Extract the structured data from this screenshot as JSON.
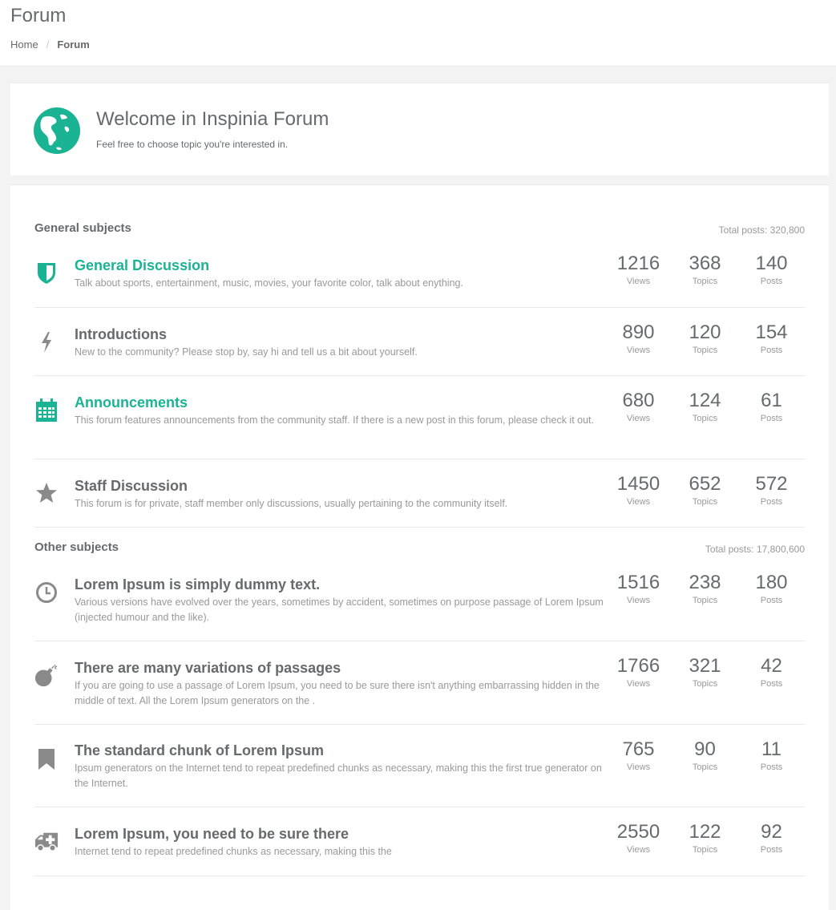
{
  "page": {
    "title": "Forum",
    "breadcrumb": {
      "home": "Home",
      "current": "Forum"
    }
  },
  "welcome": {
    "title": "Welcome in Inspinia Forum",
    "subtitle": "Feel free to choose topic you're interested in."
  },
  "labels": {
    "views": "Views",
    "topics": "Topics",
    "posts": "Posts"
  },
  "sections": [
    {
      "title": "General subjects",
      "total": "Total posts: 320,800",
      "items": [
        {
          "icon": "shield-icon",
          "title": "General Discussion",
          "highlight": true,
          "desc": "Talk about sports, entertainment, music, movies, your favorite color, talk about enything.",
          "views": "1216",
          "topics": "368",
          "posts": "140"
        },
        {
          "icon": "bolt-icon",
          "title": "Introductions",
          "highlight": false,
          "desc": "New to the community? Please stop by, say hi and tell us a bit about yourself.",
          "views": "890",
          "topics": "120",
          "posts": "154"
        },
        {
          "icon": "calendar-icon",
          "title": "Announcements",
          "highlight": true,
          "desc": "This forum features announcements from the community staff. If there is a new post in this forum, please check it out.",
          "views": "680",
          "topics": "124",
          "posts": "61"
        },
        {
          "icon": "star-icon",
          "title": "Staff Discussion",
          "highlight": false,
          "desc": "This forum is for private, staff member only discussions, usually pertaining to the community itself.",
          "views": "1450",
          "topics": "652",
          "posts": "572"
        }
      ]
    },
    {
      "title": "Other subjects",
      "total": "Total posts: 17,800,600",
      "items": [
        {
          "icon": "clock-icon",
          "title": "Lorem Ipsum is simply dummy text.",
          "highlight": false,
          "desc": "Various versions have evolved over the years, sometimes by accident, sometimes on purpose passage of Lorem Ipsum (injected humour and the like).",
          "views": "1516",
          "topics": "238",
          "posts": "180"
        },
        {
          "icon": "bomb-icon",
          "title": "There are many variations of passages",
          "highlight": false,
          "desc": "If you are going to use a passage of Lorem Ipsum, you need to be sure there isn't anything embarrassing hidden in the middle of text. All the Lorem Ipsum generators on the .",
          "views": "1766",
          "topics": "321",
          "posts": "42"
        },
        {
          "icon": "bookmark-icon",
          "title": "The standard chunk of Lorem Ipsum",
          "highlight": false,
          "desc": "Ipsum generators on the Internet tend to repeat predefined chunks as necessary, making this the first true generator on the Internet.",
          "views": "765",
          "topics": "90",
          "posts": "11"
        },
        {
          "icon": "ambulance-icon",
          "title": "Lorem Ipsum, you need to be sure there",
          "highlight": false,
          "desc": "Internet tend to repeat predefined chunks as necessary, making this the",
          "views": "2550",
          "topics": "122",
          "posts": "92"
        }
      ]
    }
  ]
}
